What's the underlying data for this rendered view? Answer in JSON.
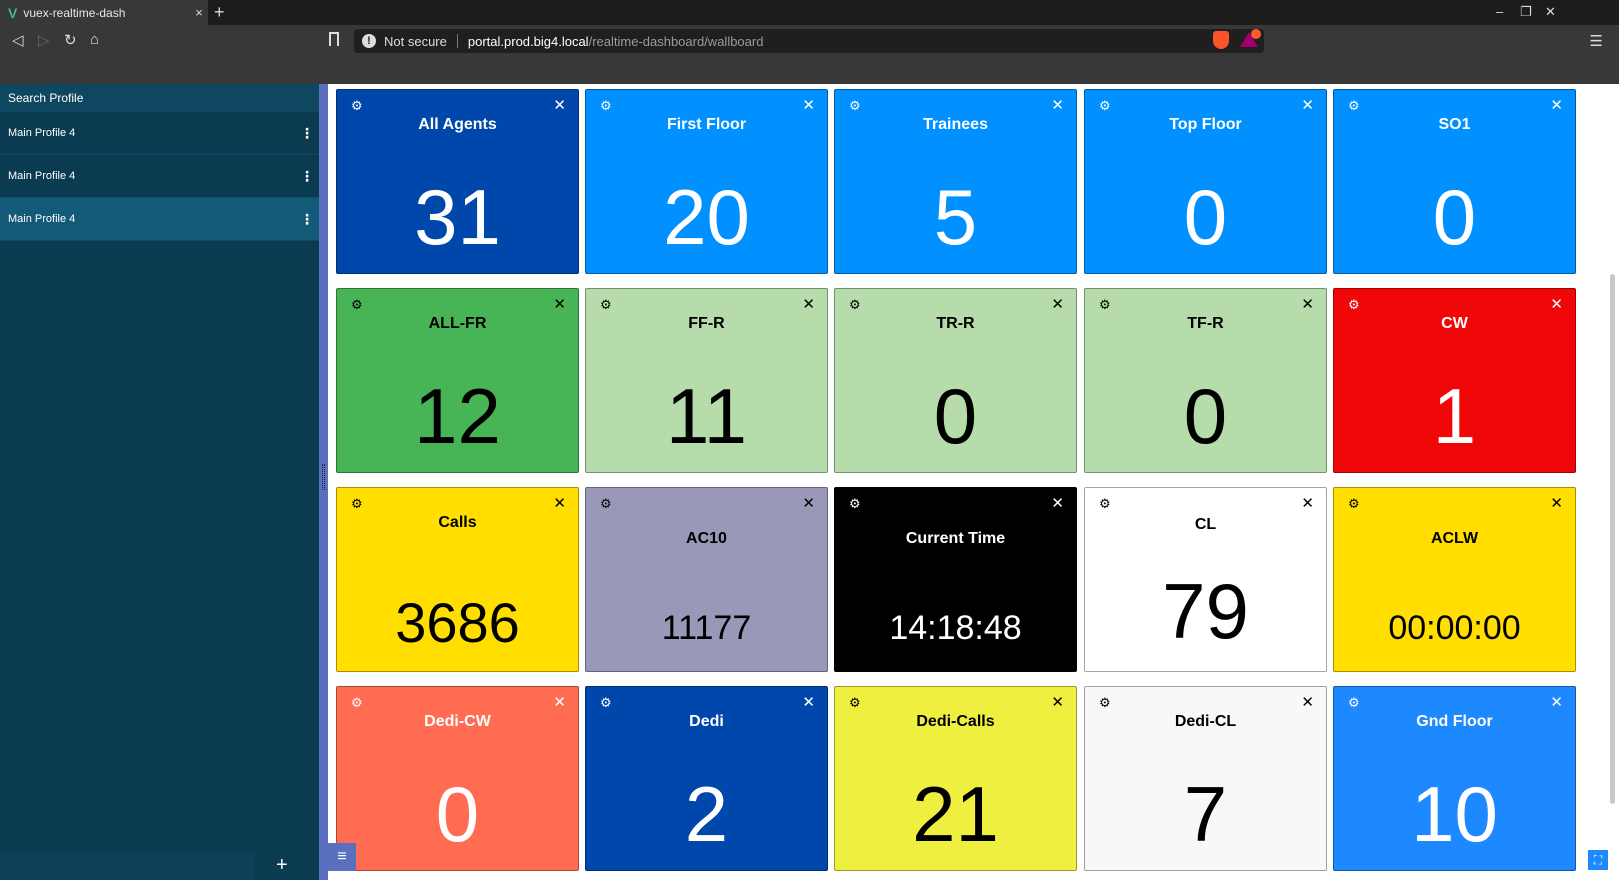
{
  "browser": {
    "tab_title": "vuex-realtime-dash",
    "tab_close": "×",
    "new_tab": "+",
    "url_security": "Not secure",
    "url_host": "portal.prod.big4.local",
    "url_path": "/realtime-dashboard/wallboard"
  },
  "sidebar": {
    "search_label": "Search Profile",
    "profiles": [
      {
        "label": "Main Profile 4"
      },
      {
        "label": "Main Profile 4"
      },
      {
        "label": "Main Profile 4"
      }
    ],
    "add_label": "+"
  },
  "colors": {
    "dark_blue": "#0047AB",
    "light_blue": "#0090FF",
    "green": "#47B455",
    "light_green": "#B5DCAA",
    "red": "#F00707",
    "yellow": "#FFDE00",
    "grey_purple": "#9A98B8",
    "black": "#000000",
    "white": "#FFFFFF",
    "salmon": "#FF6C52",
    "lime_yellow": "#EFEF40",
    "off_white": "#F7F8FA",
    "gnd_blue": "#1E88FF"
  },
  "tiles": [
    {
      "title": "All Agents",
      "value": "31"
    },
    {
      "title": "First Floor",
      "value": "20"
    },
    {
      "title": "Trainees",
      "value": "5"
    },
    {
      "title": "Top Floor",
      "value": "0"
    },
    {
      "title": "SO1",
      "value": "0"
    },
    {
      "title": "ALL-FR",
      "value": "12"
    },
    {
      "title": "FF-R",
      "value": "11"
    },
    {
      "title": "TR-R",
      "value": "0"
    },
    {
      "title": "TF-R",
      "value": "0"
    },
    {
      "title": "CW",
      "value": "1"
    },
    {
      "title": "Calls",
      "value": "3686"
    },
    {
      "title": "AC10",
      "value": "11177"
    },
    {
      "title": "Current Time",
      "value": "14:18:48"
    },
    {
      "title": "CL",
      "value": "79"
    },
    {
      "title": "ACLW",
      "value": "00:00:00"
    },
    {
      "title": "Dedi-CW",
      "value": "0"
    },
    {
      "title": "Dedi",
      "value": "2"
    },
    {
      "title": "Dedi-Calls",
      "value": "21"
    },
    {
      "title": "Dedi-CL",
      "value": "7"
    },
    {
      "title": "Gnd Floor",
      "value": "10"
    }
  ]
}
